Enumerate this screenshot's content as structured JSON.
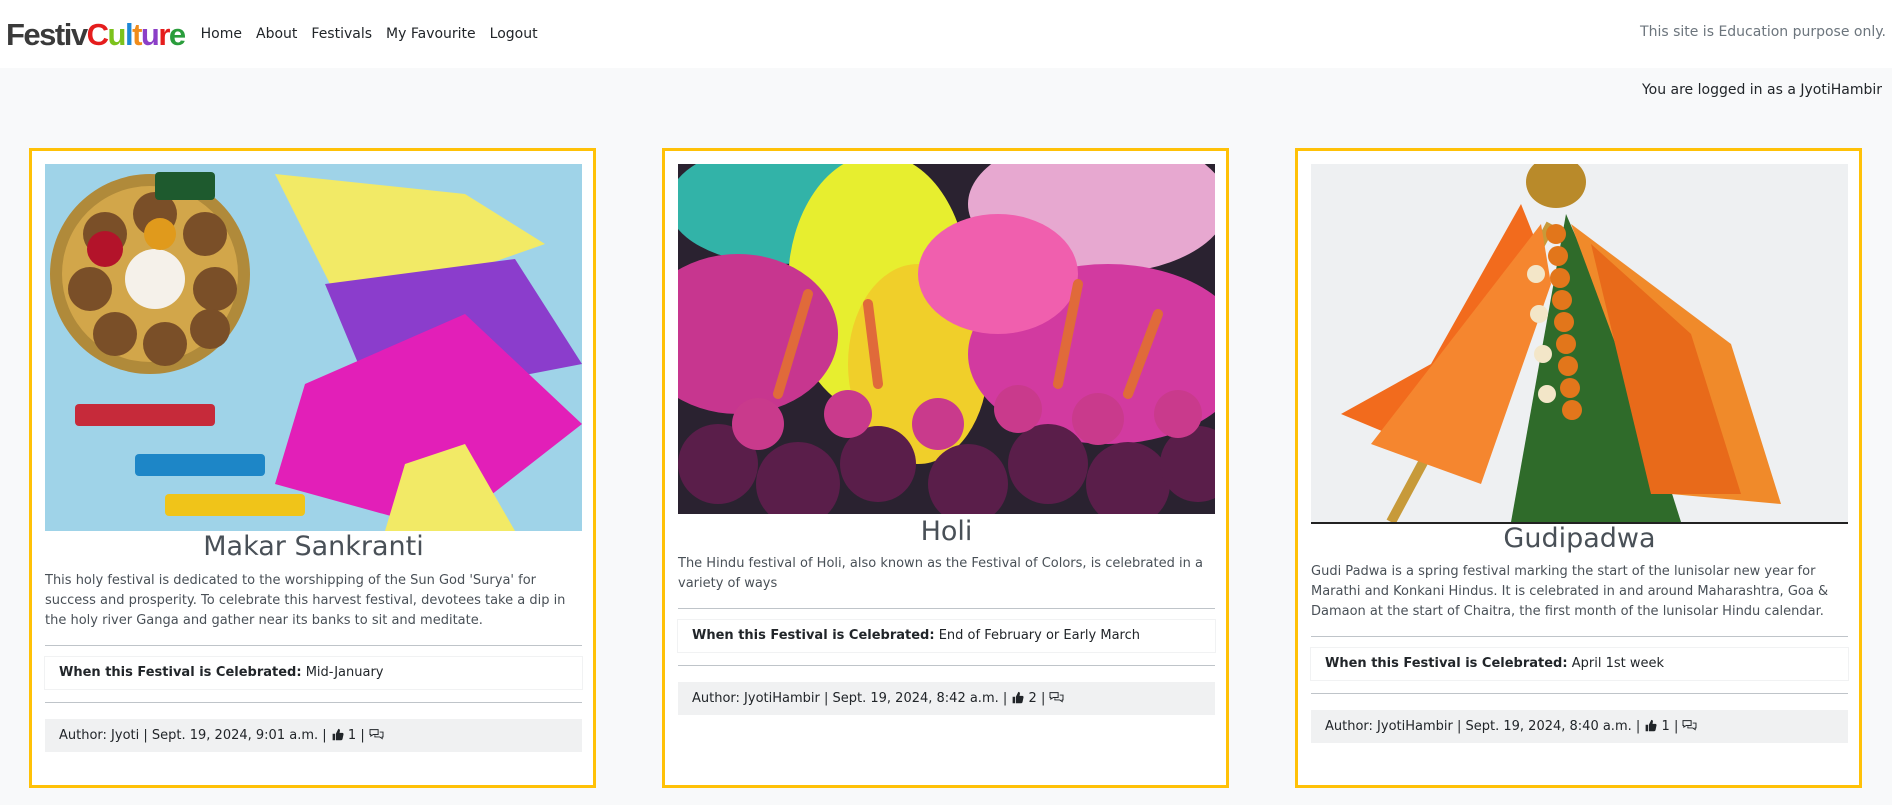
{
  "nav": {
    "brand": "FestivCulture",
    "links": [
      "Home",
      "About",
      "Festivals",
      "My Favourite",
      "Logout"
    ],
    "note": "This site is Education purpose only."
  },
  "session": {
    "text": "You are logged in as a JyotiHambir"
  },
  "when_label": "When this Festival is Celebrated:",
  "cards": [
    {
      "title": "Makar Sankranti",
      "description": "This holy festival is dedicated to the worshipping of the Sun God 'Surya' for success and prosperity. To celebrate this harvest festival, devotees take a dip in the holy river Ganga and gather near its banks to sit and meditate.",
      "when": "Mid-January",
      "author": "Author: Jyoti | Sept. 19, 2024, 9:01 a.m. |",
      "likes": "1",
      "image": "kites-and-laddoos",
      "colors": [
        "#a8d8ea",
        "#f0e35a",
        "#8a3cc9",
        "#e41eb9",
        "#8a5a2b"
      ]
    },
    {
      "title": "Holi",
      "description": "The Hindu festival of Holi, also known as the Festival of Colors, is celebrated in a variety of ways",
      "when": "End of February or Early March",
      "author": "Author: JyotiHambir | Sept. 19, 2024, 8:42 a.m. |",
      "likes": "2",
      "image": "color-powder-crowd",
      "colors": [
        "#e5ec2a",
        "#d23aa0",
        "#2fb4a6",
        "#ff5fa8",
        "#5a1e4a"
      ]
    },
    {
      "title": "Gudipadwa",
      "description": "Gudi Padwa is a spring festival marking the start of the lunisolar new year for Marathi and Konkani Hindus. It is celebrated in and around Maharashtra, Goa & Damaon at the start of Chaitra, the first month of the lunisolar Hindu calendar.",
      "when": "April 1st week",
      "author": "Author: JyotiHambir | Sept. 19, 2024, 8:40 a.m. |",
      "likes": "1",
      "image": "gudi-pole",
      "colors": [
        "#f0f0f0",
        "#f26b1d",
        "#2f6b2a",
        "#f29a2e",
        "#c08a2a"
      ]
    }
  ]
}
